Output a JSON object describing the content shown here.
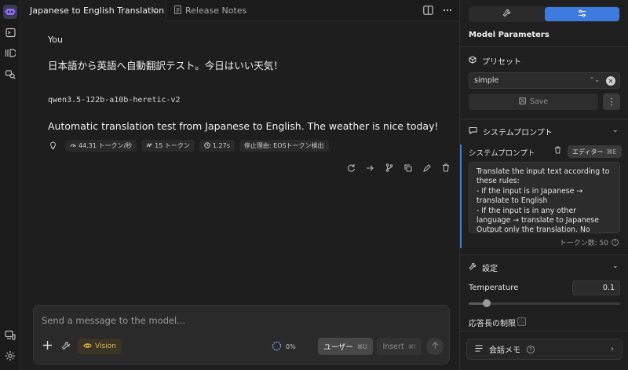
{
  "tabs": [
    {
      "label": "Japanese to English Translation",
      "active": true
    },
    {
      "label": "Release Notes",
      "active": false
    }
  ],
  "chat": {
    "user_name": "You",
    "user_message": "日本語から英語へ自動翻訳テスト。今日はいい天気！",
    "model_name": "qwen3.5-122b-a10b-heretic-v2",
    "assistant_message": "Automatic translation test from Japanese to English. The weather is nice today!",
    "stats": {
      "speed": "44.31 トークン/秒",
      "tokens": "15 トークン",
      "time": "1.27s",
      "stop_reason": "停止理由: EOSトークン検出"
    }
  },
  "composer": {
    "placeholder": "Send a message to the model...",
    "vision_label": "Vision",
    "progress": "0%",
    "user_button": "ユーザー",
    "user_shortcut": "⌘U",
    "insert_button": "Insert",
    "insert_shortcut": "⌘I"
  },
  "panel": {
    "title": "Model Parameters",
    "preset_section": "プリセット",
    "preset_value": "simple",
    "save_label": "Save",
    "system_prompt_section": "システムプロンプト",
    "system_prompt_label": "システムプロンプト",
    "editor_button": "エディター",
    "editor_shortcut": "⌘E",
    "system_prompt_text": "Translate the input text according to these rules:\n- If the input is in Japanese → translate to English\n- If the input is in any other language → translate to Japanese\nOutput only the translation. No",
    "token_count": "トークン数: 50",
    "settings_section": "設定",
    "temperature_label": "Temperature",
    "temperature_value": "0.1",
    "temperature_fraction": 0.12,
    "response_limit_label": "応答長の制限",
    "response_limit_checked": false,
    "memo_label": "会話メモ"
  },
  "colors": {
    "accent": "#3d7be0",
    "vision": "#e0b84a"
  }
}
